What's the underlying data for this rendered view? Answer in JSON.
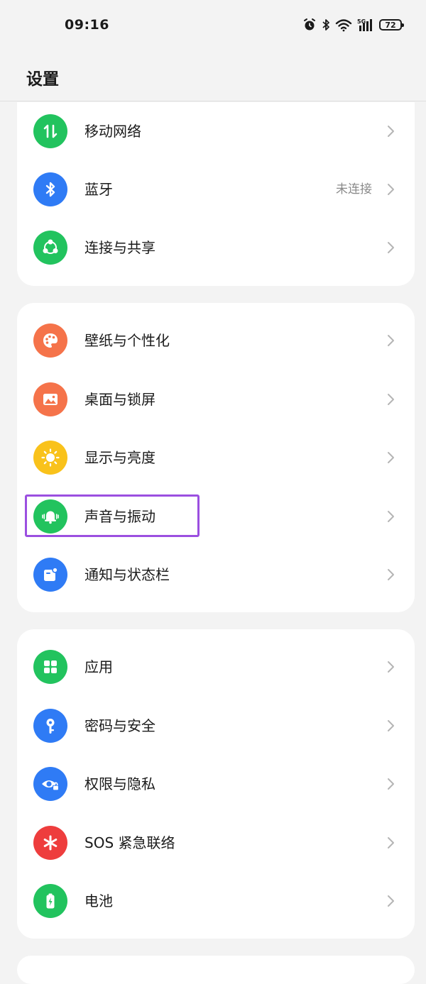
{
  "status_bar": {
    "time": "09:16",
    "battery": "72",
    "network_label": "5G"
  },
  "header": {
    "title": "设置"
  },
  "groups": [
    {
      "items": [
        {
          "label": "移动网络",
          "value": "",
          "icon": "mobile-data-icon",
          "color": "#22c35e"
        },
        {
          "label": "蓝牙",
          "value": "未连接",
          "icon": "bluetooth-icon",
          "color": "#2f7bf5"
        },
        {
          "label": "连接与共享",
          "value": "",
          "icon": "share-connect-icon",
          "color": "#22c35e"
        }
      ]
    },
    {
      "items": [
        {
          "label": "壁纸与个性化",
          "value": "",
          "icon": "palette-icon",
          "color": "#f5734a"
        },
        {
          "label": "桌面与锁屏",
          "value": "",
          "icon": "picture-icon",
          "color": "#f5734a"
        },
        {
          "label": "显示与亮度",
          "value": "",
          "icon": "sun-icon",
          "color": "#f9c21b"
        },
        {
          "label": "声音与振动",
          "value": "",
          "icon": "bell-vibrate-icon",
          "color": "#22c35e"
        },
        {
          "label": "通知与状态栏",
          "value": "",
          "icon": "notification-icon",
          "color": "#2f7bf5"
        }
      ]
    },
    {
      "items": [
        {
          "label": "应用",
          "value": "",
          "icon": "apps-grid-icon",
          "color": "#22c35e"
        },
        {
          "label": "密码与安全",
          "value": "",
          "icon": "key-icon",
          "color": "#2f7bf5"
        },
        {
          "label": "权限与隐私",
          "value": "",
          "icon": "privacy-eye-icon",
          "color": "#2f7bf5"
        },
        {
          "label": "SOS 紧急联络",
          "value": "",
          "icon": "sos-asterisk-icon",
          "color": "#ee3d3d"
        },
        {
          "label": "电池",
          "value": "",
          "icon": "battery-icon",
          "color": "#22c35e"
        }
      ]
    }
  ],
  "highlight": {
    "target": "声音与振动",
    "color": "#9b4fe0"
  }
}
